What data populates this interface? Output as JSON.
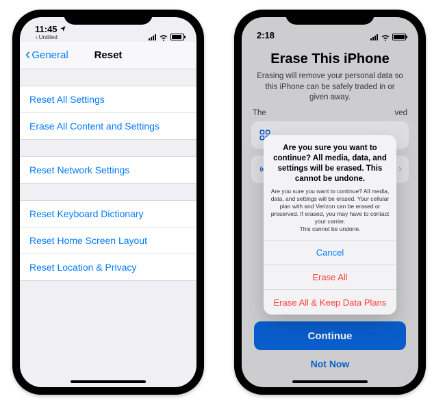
{
  "left": {
    "status": {
      "time": "11:45",
      "tab_label": "Untitled"
    },
    "nav": {
      "back": "General",
      "title": "Reset"
    },
    "group1": [
      "Reset All Settings",
      "Erase All Content and Settings"
    ],
    "group2": [
      "Reset Network Settings"
    ],
    "group3": [
      "Reset Keyboard Dictionary",
      "Reset Home Screen Layout",
      "Reset Location & Privacy"
    ]
  },
  "right": {
    "status": {
      "time": "2:18"
    },
    "title": "Erase This iPhone",
    "subtitle": "Erasing will remove your personal data so this iPhone can be safely traded in or given away.",
    "peek_text_left": "The",
    "peek_text_right": "ved",
    "alert": {
      "title": "Are you sure you want to continue? All media, data, and settings will be erased. This cannot be undone.",
      "message": "Are you sure you want to continue? All media, data, and settings will be erased. Your cellular plan with  and Verizon can be erased or preserved. If erased, you may have to contact your carrier.\nThis cannot be undone.",
      "cancel": "Cancel",
      "erase_all": "Erase All",
      "erase_keep": "Erase All & Keep Data Plans"
    },
    "continue": "Continue",
    "not_now": "Not Now"
  },
  "colors": {
    "ios_blue": "#007aff",
    "system_blue_dark": "#0a63d6",
    "destructive": "#ff3b30"
  }
}
